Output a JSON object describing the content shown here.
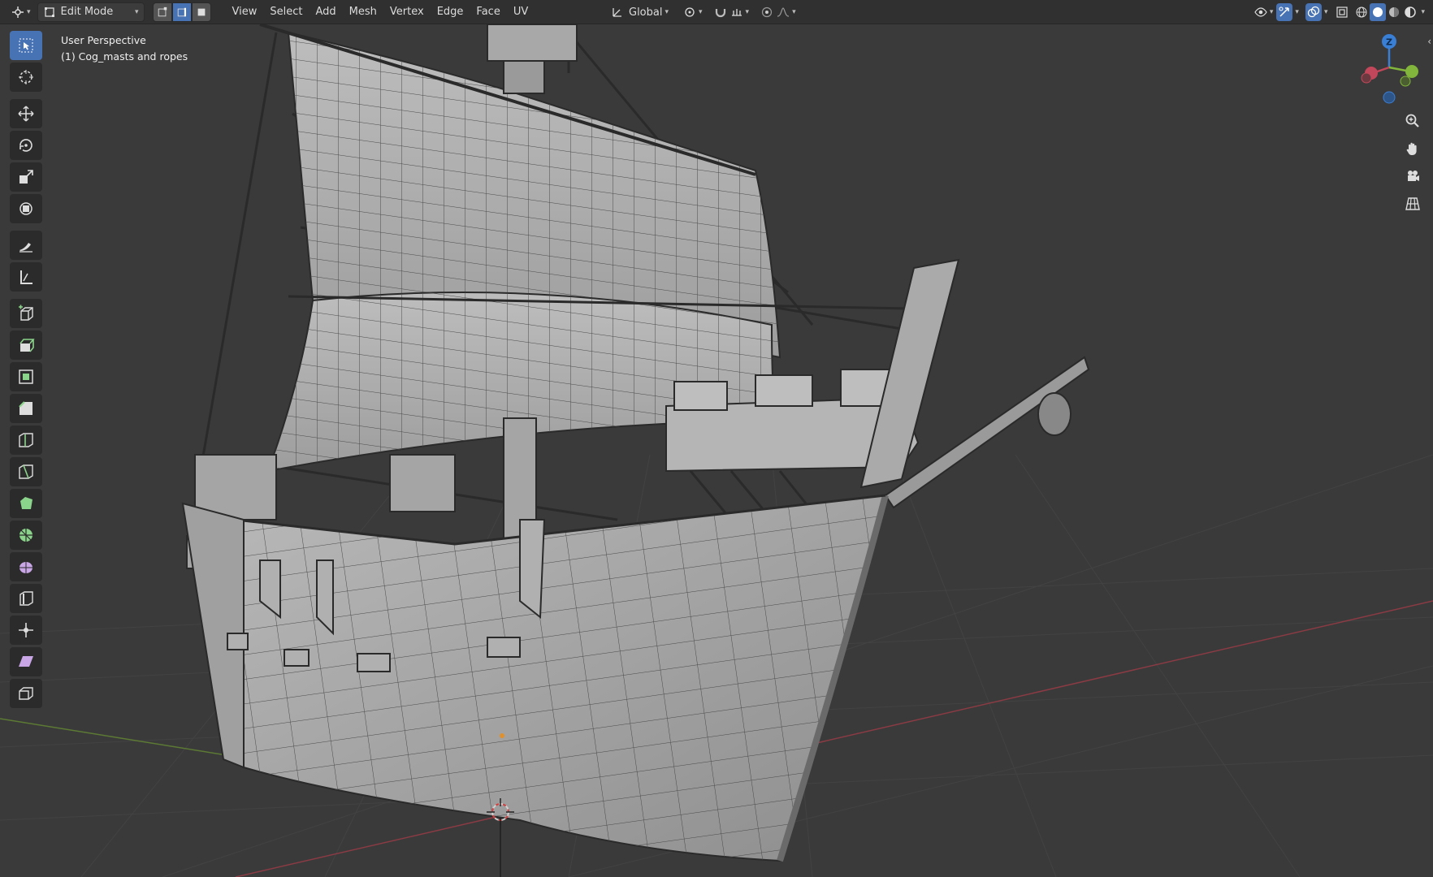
{
  "header": {
    "editor_type_icon": "3d-viewport-icon",
    "mode": "Edit Mode",
    "select_modes": [
      "vertex-select-icon",
      "edge-select-icon",
      "face-select-icon"
    ],
    "active_select_mode": "edge",
    "menus": [
      "View",
      "Select",
      "Add",
      "Mesh",
      "Vertex",
      "Edge",
      "Face",
      "UV"
    ],
    "transform_orientation": "Global",
    "shading_active": "solid"
  },
  "overlay": {
    "view_name": "User Perspective",
    "object_name": "(1) Cog_masts and ropes"
  },
  "toolbar": {
    "tools": [
      "select-box-icon",
      "cursor-icon",
      "move-icon",
      "rotate-icon",
      "scale-icon",
      "transform-icon",
      "annotate-icon",
      "measure-icon",
      "add-cube-icon",
      "extrude-icon",
      "inset-icon",
      "bevel-icon",
      "loop-cut-icon",
      "knife-icon",
      "poly-build-icon",
      "spin-icon",
      "smooth-icon",
      "edge-slide-icon",
      "shrink-fatten-icon",
      "shear-icon",
      "rip-icon"
    ],
    "active_tool": "select-box-icon"
  },
  "gizmo": {
    "z_label": "Z"
  },
  "colors": {
    "accent": "#4772b3",
    "header_bg": "#303030",
    "viewport_bg": "#3a3a3a",
    "axis_x": "#c3475a",
    "axis_y": "#82b53b",
    "axis_z": "#3a7fd6"
  }
}
